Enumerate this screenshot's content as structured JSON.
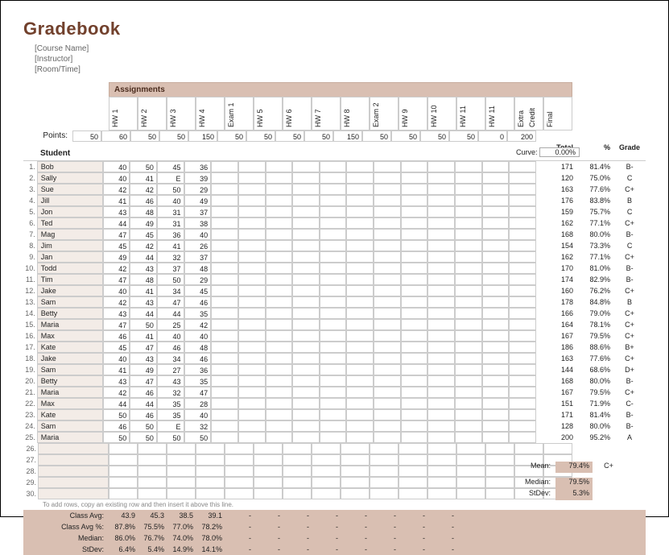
{
  "title": "Gradebook",
  "meta": [
    "[Course Name]",
    "[Instructor]",
    "[Room/Time]"
  ],
  "assignments_label": "Assignments",
  "points_label": "Points:",
  "student_label": "Student",
  "curve_label": "Curve:",
  "curve_value": "0.00%",
  "totals_header": {
    "total": "Total",
    "pct": "%",
    "grade": "Grade"
  },
  "assignments": [
    {
      "name": "HW 1",
      "pts": "50"
    },
    {
      "name": "HW 2",
      "pts": "60"
    },
    {
      "name": "HW 3",
      "pts": "50"
    },
    {
      "name": "HW 4",
      "pts": "50"
    },
    {
      "name": "Exam 1",
      "pts": "150"
    },
    {
      "name": "HW 5",
      "pts": "50"
    },
    {
      "name": "HW 6",
      "pts": "50"
    },
    {
      "name": "HW 7",
      "pts": "50"
    },
    {
      "name": "HW 8",
      "pts": "50"
    },
    {
      "name": "Exam 2",
      "pts": "150"
    },
    {
      "name": "HW 9",
      "pts": "50"
    },
    {
      "name": "HW 10",
      "pts": "50"
    },
    {
      "name": "HW 11",
      "pts": "50"
    },
    {
      "name": "HW 11",
      "pts": "50"
    },
    {
      "name": "Extra Credit",
      "pts": "0"
    },
    {
      "name": "Final",
      "pts": "200"
    }
  ],
  "students": [
    {
      "n": "1.",
      "name": "Bob",
      "s": [
        "40",
        "50",
        "45",
        "36"
      ],
      "tot": "171",
      "pct": "81.4%",
      "g": "B-"
    },
    {
      "n": "2.",
      "name": "Sally",
      "s": [
        "40",
        "41",
        "E",
        "39"
      ],
      "tot": "120",
      "pct": "75.0%",
      "g": "C"
    },
    {
      "n": "3.",
      "name": "Sue",
      "s": [
        "42",
        "42",
        "50",
        "29"
      ],
      "tot": "163",
      "pct": "77.6%",
      "g": "C+"
    },
    {
      "n": "4.",
      "name": "Jill",
      "s": [
        "41",
        "46",
        "40",
        "49"
      ],
      "tot": "176",
      "pct": "83.8%",
      "g": "B"
    },
    {
      "n": "5.",
      "name": "Jon",
      "s": [
        "43",
        "48",
        "31",
        "37"
      ],
      "tot": "159",
      "pct": "75.7%",
      "g": "C"
    },
    {
      "n": "6.",
      "name": "Ted",
      "s": [
        "44",
        "49",
        "31",
        "38"
      ],
      "tot": "162",
      "pct": "77.1%",
      "g": "C+"
    },
    {
      "n": "7.",
      "name": "Mag",
      "s": [
        "47",
        "45",
        "36",
        "40"
      ],
      "tot": "168",
      "pct": "80.0%",
      "g": "B-"
    },
    {
      "n": "8.",
      "name": "Jim",
      "s": [
        "45",
        "42",
        "41",
        "26"
      ],
      "tot": "154",
      "pct": "73.3%",
      "g": "C"
    },
    {
      "n": "9.",
      "name": "Jan",
      "s": [
        "49",
        "44",
        "32",
        "37"
      ],
      "tot": "162",
      "pct": "77.1%",
      "g": "C+"
    },
    {
      "n": "10.",
      "name": "Todd",
      "s": [
        "42",
        "43",
        "37",
        "48"
      ],
      "tot": "170",
      "pct": "81.0%",
      "g": "B-"
    },
    {
      "n": "11.",
      "name": "Tim",
      "s": [
        "47",
        "48",
        "50",
        "29"
      ],
      "tot": "174",
      "pct": "82.9%",
      "g": "B-"
    },
    {
      "n": "12.",
      "name": "Jake",
      "s": [
        "40",
        "41",
        "34",
        "45"
      ],
      "tot": "160",
      "pct": "76.2%",
      "g": "C+"
    },
    {
      "n": "13.",
      "name": "Sam",
      "s": [
        "42",
        "43",
        "47",
        "46"
      ],
      "tot": "178",
      "pct": "84.8%",
      "g": "B"
    },
    {
      "n": "14.",
      "name": "Betty",
      "s": [
        "43",
        "44",
        "44",
        "35"
      ],
      "tot": "166",
      "pct": "79.0%",
      "g": "C+"
    },
    {
      "n": "15.",
      "name": "Maria",
      "s": [
        "47",
        "50",
        "25",
        "42"
      ],
      "tot": "164",
      "pct": "78.1%",
      "g": "C+"
    },
    {
      "n": "16.",
      "name": "Max",
      "s": [
        "46",
        "41",
        "40",
        "40"
      ],
      "tot": "167",
      "pct": "79.5%",
      "g": "C+"
    },
    {
      "n": "17.",
      "name": "Kate",
      "s": [
        "45",
        "47",
        "46",
        "48"
      ],
      "tot": "186",
      "pct": "88.6%",
      "g": "B+"
    },
    {
      "n": "18.",
      "name": "Jake",
      "s": [
        "40",
        "43",
        "34",
        "46"
      ],
      "tot": "163",
      "pct": "77.6%",
      "g": "C+"
    },
    {
      "n": "19.",
      "name": "Sam",
      "s": [
        "41",
        "49",
        "27",
        "36"
      ],
      "tot": "144",
      "pct": "68.6%",
      "g": "D+"
    },
    {
      "n": "20.",
      "name": "Betty",
      "s": [
        "43",
        "47",
        "43",
        "35"
      ],
      "tot": "168",
      "pct": "80.0%",
      "g": "B-"
    },
    {
      "n": "21.",
      "name": "Maria",
      "s": [
        "42",
        "46",
        "32",
        "47"
      ],
      "tot": "167",
      "pct": "79.5%",
      "g": "C+"
    },
    {
      "n": "22.",
      "name": "Max",
      "s": [
        "44",
        "44",
        "35",
        "28"
      ],
      "tot": "151",
      "pct": "71.9%",
      "g": "C-"
    },
    {
      "n": "23.",
      "name": "Kate",
      "s": [
        "50",
        "46",
        "35",
        "40"
      ],
      "tot": "171",
      "pct": "81.4%",
      "g": "B-"
    },
    {
      "n": "24.",
      "name": "Sam",
      "s": [
        "46",
        "50",
        "E",
        "32"
      ],
      "tot": "128",
      "pct": "80.0%",
      "g": "B-"
    },
    {
      "n": "25.",
      "name": "Maria",
      "s": [
        "50",
        "50",
        "50",
        "50"
      ],
      "tot": "200",
      "pct": "95.2%",
      "g": "A"
    }
  ],
  "empty_rows": [
    "26.",
    "27.",
    "28.",
    "29.",
    "30."
  ],
  "footnote": "To add rows, copy an existing row and then insert it above this line.",
  "summary": {
    "ClassAvg": {
      "label": "Class Avg:",
      "v": [
        "43.9",
        "45.3",
        "38.5",
        "39.1"
      ]
    },
    "ClassAvgPct": {
      "label": "Class Avg %:",
      "v": [
        "87.8%",
        "75.5%",
        "77.0%",
        "78.2%"
      ]
    },
    "Median": {
      "label": "Median:",
      "v": [
        "86.0%",
        "76.7%",
        "74.0%",
        "78.0%"
      ]
    },
    "StDev": {
      "label": "StDev:",
      "v": [
        "6.4%",
        "5.4%",
        "14.9%",
        "14.1%"
      ]
    }
  },
  "rightsum": {
    "mean": {
      "label": "Mean:",
      "val": "79.4%",
      "grade": "C+"
    },
    "median": {
      "label": "Median:",
      "val": "79.5%",
      "grade": ""
    },
    "stdev": {
      "label": "StDev:",
      "val": "5.3%",
      "grade": ""
    }
  }
}
